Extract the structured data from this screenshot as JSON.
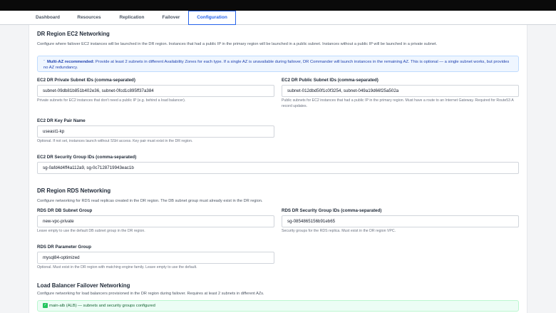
{
  "tabs": [
    {
      "label": "Dashboard"
    },
    {
      "label": "Resources"
    },
    {
      "label": "Replication"
    },
    {
      "label": "Failover"
    },
    {
      "label": "Configuration"
    }
  ],
  "ec2": {
    "title": "DR Region EC2 Networking",
    "description": "Configure where failover EC2 instances will be launched in the DR region. Instances that had a public IP in the primary region will be launched in a public subnet. Instances without a public IP will be launched in a private subnet.",
    "note_icon": "ˉ",
    "note_bold": "Multi-AZ recommended:",
    "note_text": " Provide at least 2 subnets in different Availability Zones for each type. If a single AZ is unavailable during failover, DR Commander will launch instances in the remaining AZ. This is optional — a single subnet works, but provides no AZ redundancy.",
    "private_subnets": {
      "label": "EC2 DR Private Subnet IDs (comma-separated)",
      "value": "subnet-09db81b851b402e36, subnet-0fcd1c895ff37a384",
      "help": "Private subnets for EC2 instances that don't need a public IP (e.g. behind a load balancer)."
    },
    "public_subnets": {
      "label": "EC2 DR Public Subnet IDs (comma-separated)",
      "value": "subnet-012dbd50f1c0f3254, subnet-049a19d66f25a502a",
      "help": "Public subnets for EC2 instances that had a public IP in the primary region. Must have a route to an Internet Gateway. Required for Route53 A record updates."
    },
    "key_pair": {
      "label": "EC2 DR Key Pair Name",
      "value": "useast1-kp",
      "help": "Optional. If not set, instances launch without SSH access. Key pair must exist in the DR region."
    },
    "security_groups": {
      "label": "EC2 DR Security Group IDs (comma-separated)",
      "value": "sg-0afd4d4ff4a112a9, sg-0c7128719943eac1b"
    }
  },
  "rds": {
    "title": "DR Region RDS Networking",
    "description": "Configure networking for RDS read replicas created in the DR region. The DB subnet group must already exist in the DR region.",
    "subnet_group": {
      "label": "RDS DR DB Subnet Group",
      "value": "new-vpc-private",
      "help": "Leave empty to use the default DB subnet group in the DR region."
    },
    "security_groups": {
      "label": "RDS DR Security Group IDs (comma-separated)",
      "value": "sg-0854865156b91eb65",
      "help": "Security groups for the RDS replica. Must exist in the DR region VPC."
    },
    "parameter_group": {
      "label": "RDS DR Parameter Group",
      "value": "mysql84-optimized",
      "help": "Optional. Must exist in the DR region with matching engine family. Leave empty to use the default."
    }
  },
  "lb": {
    "title": "Load Balancer Failover Networking",
    "description": "Configure networking for load balancers provisioned in the DR region during failover. Requires at least 2 subnets in different AZs.",
    "status_text": "main-alb (ALB) — subnets and security groups configured",
    "status_icon_glyph": "✓"
  },
  "colors": {
    "accent": "#2563eb",
    "note_bg": "#eff6ff",
    "success_bg": "#ecfdf5",
    "success_icon": "#22c55e"
  }
}
